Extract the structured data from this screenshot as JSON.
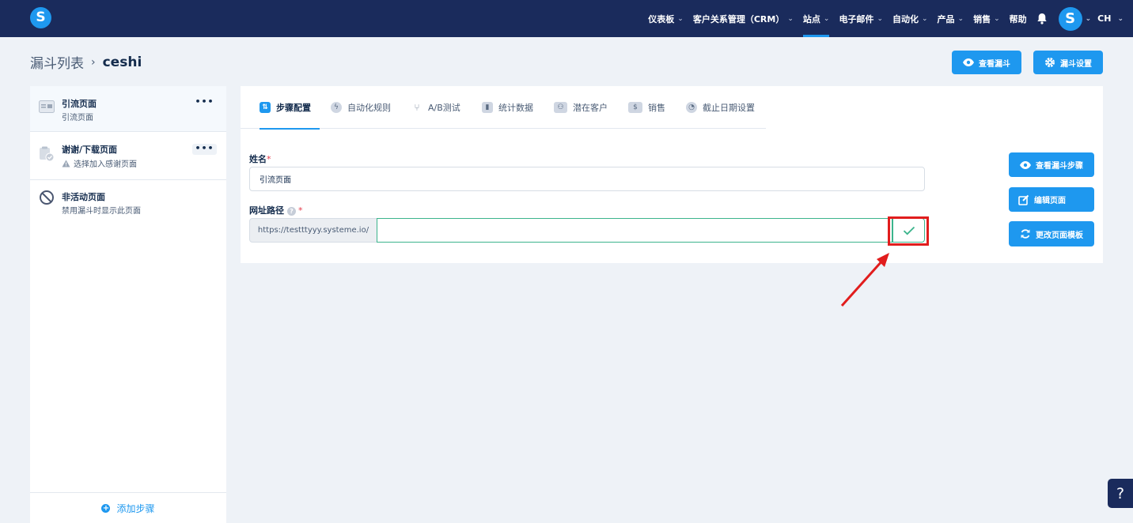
{
  "app": {
    "logo_letter": "S"
  },
  "nav": {
    "items": [
      {
        "label": "仪表板",
        "chevron": true,
        "active": false
      },
      {
        "label": "客户关系管理（CRM）",
        "chevron": true,
        "active": false
      },
      {
        "label": "站点",
        "chevron": true,
        "active": true
      },
      {
        "label": "电子邮件",
        "chevron": true,
        "active": false
      },
      {
        "label": "自动化",
        "chevron": true,
        "active": false
      },
      {
        "label": "产品",
        "chevron": true,
        "active": false
      },
      {
        "label": "销售",
        "chevron": true,
        "active": false
      },
      {
        "label": "帮助",
        "chevron": false,
        "active": false
      }
    ],
    "avatar_letter": "S",
    "language": "CH"
  },
  "breadcrumb": {
    "root": "漏斗列表",
    "current": "ceshi"
  },
  "header_buttons": {
    "view_funnel": "查看漏斗",
    "funnel_settings": "漏斗设置"
  },
  "steps": [
    {
      "title": "引流页面",
      "subtitle": "引流页面",
      "icon": "page-icon",
      "selected": true,
      "has_menu": true
    },
    {
      "title": "谢谢/下载页面",
      "subtitle": "选择加入感谢页面",
      "icon": "clipboard-check-icon",
      "selected": false,
      "has_menu": true
    },
    {
      "title": "非活动页面",
      "subtitle": "禁用漏斗时显示此页面",
      "icon": "ban-icon",
      "selected": false,
      "has_menu": false
    }
  ],
  "add_step_label": "添加步骤",
  "tabs": [
    {
      "label": "步骤配置",
      "icon": "sliders-icon",
      "active": true
    },
    {
      "label": "自动化规则",
      "icon": "bolt-icon",
      "active": false
    },
    {
      "label": "A/B测试",
      "icon": "split-icon",
      "active": false
    },
    {
      "label": "统计数据",
      "icon": "bar-chart-icon",
      "active": false
    },
    {
      "label": "潜在客户",
      "icon": "users-icon",
      "active": false
    },
    {
      "label": "销售",
      "icon": "dollar-icon",
      "active": false
    },
    {
      "label": "截止日期设置",
      "icon": "clock-icon",
      "active": false
    }
  ],
  "form": {
    "name_label": "姓名",
    "name_value": "引流页面",
    "url_label": "网址路径",
    "url_prefix": "https://testttyyy.systeme.io/",
    "url_value": "",
    "required_mark": "*"
  },
  "side_buttons": {
    "view_steps": "查看漏斗步骤",
    "edit_page": "编辑页面",
    "change_template": "更改页面模板"
  },
  "help_button": "?",
  "colors": {
    "nav_bg": "#1a2b5c",
    "accent": "#1e98ef",
    "valid": "#3cb48c",
    "annotation": "#e11d1d"
  }
}
